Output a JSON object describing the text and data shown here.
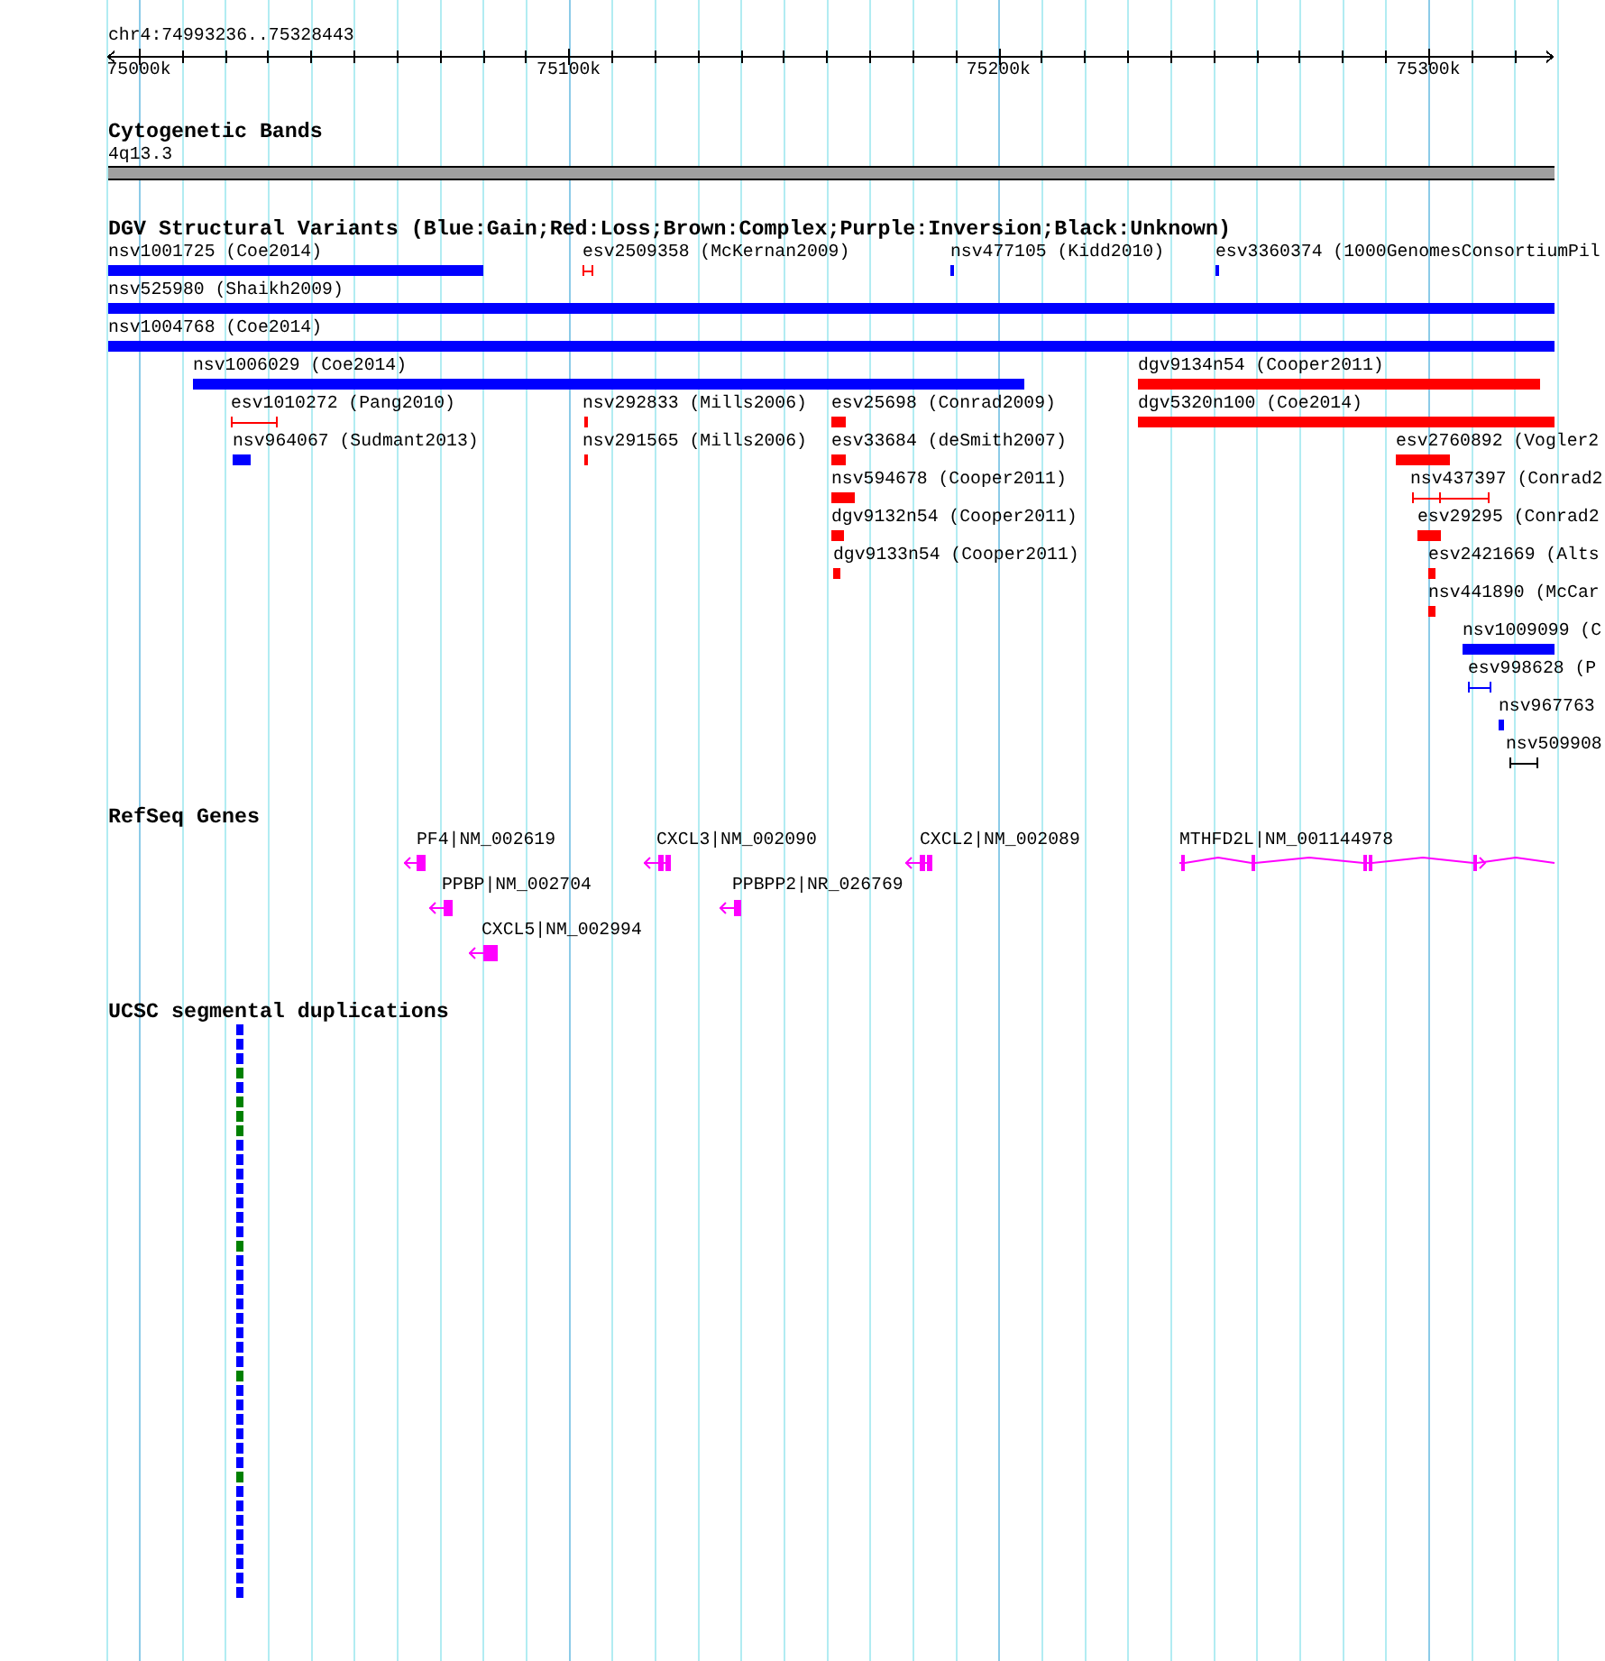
{
  "ruler": {
    "region": "chr4:74993236..75328443",
    "ticks": [
      "75000k",
      "75100k",
      "75200k",
      "75300k"
    ]
  },
  "cytobands": {
    "title": "Cytogenetic Bands",
    "bands": [
      {
        "name": "4q13.3"
      }
    ]
  },
  "dgv": {
    "title": "DGV Structural Variants (Blue:Gain;Red:Loss;Brown:Complex;Purple:Inversion;Black:Unknown)",
    "features": [
      {
        "label": "nsv1001725 (Coe2014)",
        "color": "#0000ff",
        "kind": "bar"
      },
      {
        "label": "esv2509358 (McKernan2009)",
        "color": "#ff0000",
        "kind": "span"
      },
      {
        "label": "nsv477105 (Kidd2010)",
        "color": "#0000ff",
        "kind": "bar"
      },
      {
        "label": "esv3360374 (1000GenomesConsortiumPil",
        "color": "#0000ff",
        "kind": "bar"
      },
      {
        "label": "nsv525980 (Shaikh2009)",
        "color": "#0000ff",
        "kind": "bar"
      },
      {
        "label": "nsv1004768 (Coe2014)",
        "color": "#0000ff",
        "kind": "bar"
      },
      {
        "label": "nsv1006029 (Coe2014)",
        "color": "#0000ff",
        "kind": "bar"
      },
      {
        "label": "dgv9134n54 (Cooper2011)",
        "color": "#ff0000",
        "kind": "bar"
      },
      {
        "label": "esv1010272 (Pang2010)",
        "color": "#ff0000",
        "kind": "span"
      },
      {
        "label": "nsv292833 (Mills2006)",
        "color": "#ff0000",
        "kind": "bar"
      },
      {
        "label": "esv25698 (Conrad2009)",
        "color": "#ff0000",
        "kind": "bar"
      },
      {
        "label": "dgv5320n100 (Coe2014)",
        "color": "#ff0000",
        "kind": "bar"
      },
      {
        "label": "nsv964067 (Sudmant2013)",
        "color": "#0000ff",
        "kind": "bar"
      },
      {
        "label": "nsv291565 (Mills2006)",
        "color": "#ff0000",
        "kind": "bar"
      },
      {
        "label": "esv33684 (deSmith2007)",
        "color": "#ff0000",
        "kind": "bar"
      },
      {
        "label": "esv2760892 (Vogler2",
        "color": "#ff0000",
        "kind": "bar"
      },
      {
        "label": "nsv594678 (Cooper2011)",
        "color": "#ff0000",
        "kind": "bar"
      },
      {
        "label": "nsv437397 (Conrad2",
        "color": "#ff0000",
        "kind": "span"
      },
      {
        "label": "dgv9132n54 (Cooper2011)",
        "color": "#ff0000",
        "kind": "bar"
      },
      {
        "label": "esv29295 (Conrad2",
        "color": "#ff0000",
        "kind": "bar"
      },
      {
        "label": "dgv9133n54 (Cooper2011)",
        "color": "#ff0000",
        "kind": "bar"
      },
      {
        "label": "esv2421669 (Alts",
        "color": "#ff0000",
        "kind": "bar"
      },
      {
        "label": "nsv441890 (McCar",
        "color": "#ff0000",
        "kind": "bar"
      },
      {
        "label": "nsv1009099 (C",
        "color": "#0000ff",
        "kind": "bar"
      },
      {
        "label": "esv998628 (P",
        "color": "#0000ff",
        "kind": "span"
      },
      {
        "label": "nsv967763",
        "color": "#0000ff",
        "kind": "bar"
      },
      {
        "label": "nsv509908",
        "color": "#000000",
        "kind": "span"
      }
    ]
  },
  "refseq": {
    "title": "RefSeq Genes",
    "genes": [
      {
        "label": "PF4|NM_002619",
        "reverse": true
      },
      {
        "label": "CXCL3|NM_002090",
        "reverse": true
      },
      {
        "label": "CXCL2|NM_002089",
        "reverse": true
      },
      {
        "label": "MTHFD2L|NM_001144978",
        "reverse": false
      },
      {
        "label": "PPBP|NM_002704",
        "reverse": true
      },
      {
        "label": "PPBPP2|NR_026769",
        "reverse": true
      },
      {
        "label": "CXCL5|NM_002994",
        "reverse": true
      }
    ]
  },
  "segdups": {
    "title": "UCSC segmental duplications",
    "features": [
      {
        "color": "#0000ff"
      },
      {
        "color": "#0000ff"
      },
      {
        "color": "#0000ff"
      },
      {
        "color": "#008000"
      },
      {
        "color": "#0000ff"
      },
      {
        "color": "#008000"
      },
      {
        "color": "#008000"
      },
      {
        "color": "#008000"
      },
      {
        "color": "#0000ff"
      },
      {
        "color": "#0000ff"
      },
      {
        "color": "#0000ff"
      },
      {
        "color": "#0000ff"
      },
      {
        "color": "#0000ff"
      },
      {
        "color": "#0000ff"
      },
      {
        "color": "#0000ff"
      },
      {
        "color": "#008000"
      },
      {
        "color": "#0000ff"
      },
      {
        "color": "#0000ff"
      },
      {
        "color": "#0000ff"
      },
      {
        "color": "#0000ff"
      },
      {
        "color": "#0000ff"
      },
      {
        "color": "#0000ff"
      },
      {
        "color": "#0000ff"
      },
      {
        "color": "#0000ff"
      },
      {
        "color": "#008000"
      },
      {
        "color": "#0000ff"
      },
      {
        "color": "#0000ff"
      },
      {
        "color": "#0000ff"
      },
      {
        "color": "#0000ff"
      },
      {
        "color": "#0000ff"
      },
      {
        "color": "#0000ff"
      },
      {
        "color": "#008000"
      },
      {
        "color": "#0000ff"
      },
      {
        "color": "#0000ff"
      },
      {
        "color": "#0000ff"
      },
      {
        "color": "#0000ff"
      },
      {
        "color": "#0000ff"
      },
      {
        "color": "#0000ff"
      },
      {
        "color": "#0000ff"
      },
      {
        "color": "#0000ff"
      }
    ]
  }
}
